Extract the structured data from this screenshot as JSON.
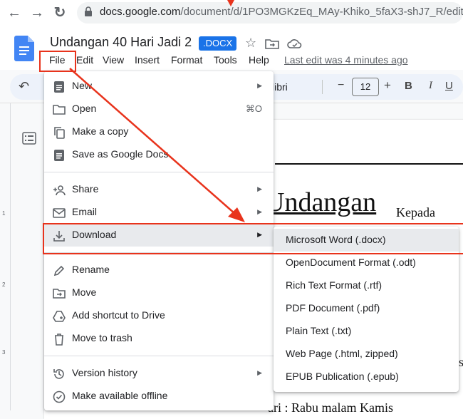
{
  "browser": {
    "url_domain": "docs.google.com",
    "url_path": "/document/d/1PO3MGKzEq_MAy-Khiko_5faX3-shJ7_R/edit"
  },
  "doc": {
    "title": "Undangan 40 Hari Jadi 2",
    "badge": ".DOCX"
  },
  "menubar": {
    "items": [
      "File",
      "Edit",
      "View",
      "Insert",
      "Format",
      "Tools",
      "Help"
    ],
    "last_edit": "Last edit was 4 minutes ago"
  },
  "toolbar": {
    "font_fragment": "libri",
    "font_size": "12",
    "minus": "−",
    "plus": "+",
    "bold": "B",
    "italic": "I",
    "underline": "U"
  },
  "ruler": {
    "marks": [
      "1",
      "2",
      "3"
    ]
  },
  "page_text": {
    "heading": "Undangan",
    "kepada": "Kepada",
    "bottom": "ari : Rabu malam Kamis",
    "fragment_s": "s"
  },
  "file_menu": {
    "items": [
      {
        "label": "New",
        "icon": "new-doc-icon",
        "arrow": true
      },
      {
        "label": "Open",
        "icon": "folder-icon",
        "shortcut": "⌘O"
      },
      {
        "label": "Make a copy",
        "icon": "copy-icon"
      },
      {
        "label": "Save as Google Docs",
        "icon": "docs-icon"
      },
      {
        "label": "Share",
        "icon": "share-person-icon",
        "arrow": true
      },
      {
        "label": "Email",
        "icon": "email-icon",
        "arrow": true
      },
      {
        "label": "Download",
        "icon": "download-icon",
        "arrow": true
      },
      {
        "label": "Rename",
        "icon": "rename-icon"
      },
      {
        "label": "Move",
        "icon": "move-folder-icon"
      },
      {
        "label": "Add shortcut to Drive",
        "icon": "drive-shortcut-icon"
      },
      {
        "label": "Move to trash",
        "icon": "trash-icon"
      },
      {
        "label": "Version history",
        "icon": "history-icon",
        "arrow": true
      },
      {
        "label": "Make available offline",
        "icon": "offline-icon"
      }
    ]
  },
  "download_submenu": {
    "items": [
      "Microsoft Word (.docx)",
      "OpenDocument Format (.odt)",
      "Rich Text Format (.rtf)",
      "PDF Document (.pdf)",
      "Plain Text (.txt)",
      "Web Page (.html, zipped)",
      "EPUB Publication (.epub)"
    ]
  },
  "annotation_color": "#e8331c",
  "accent": "#1a73e8"
}
